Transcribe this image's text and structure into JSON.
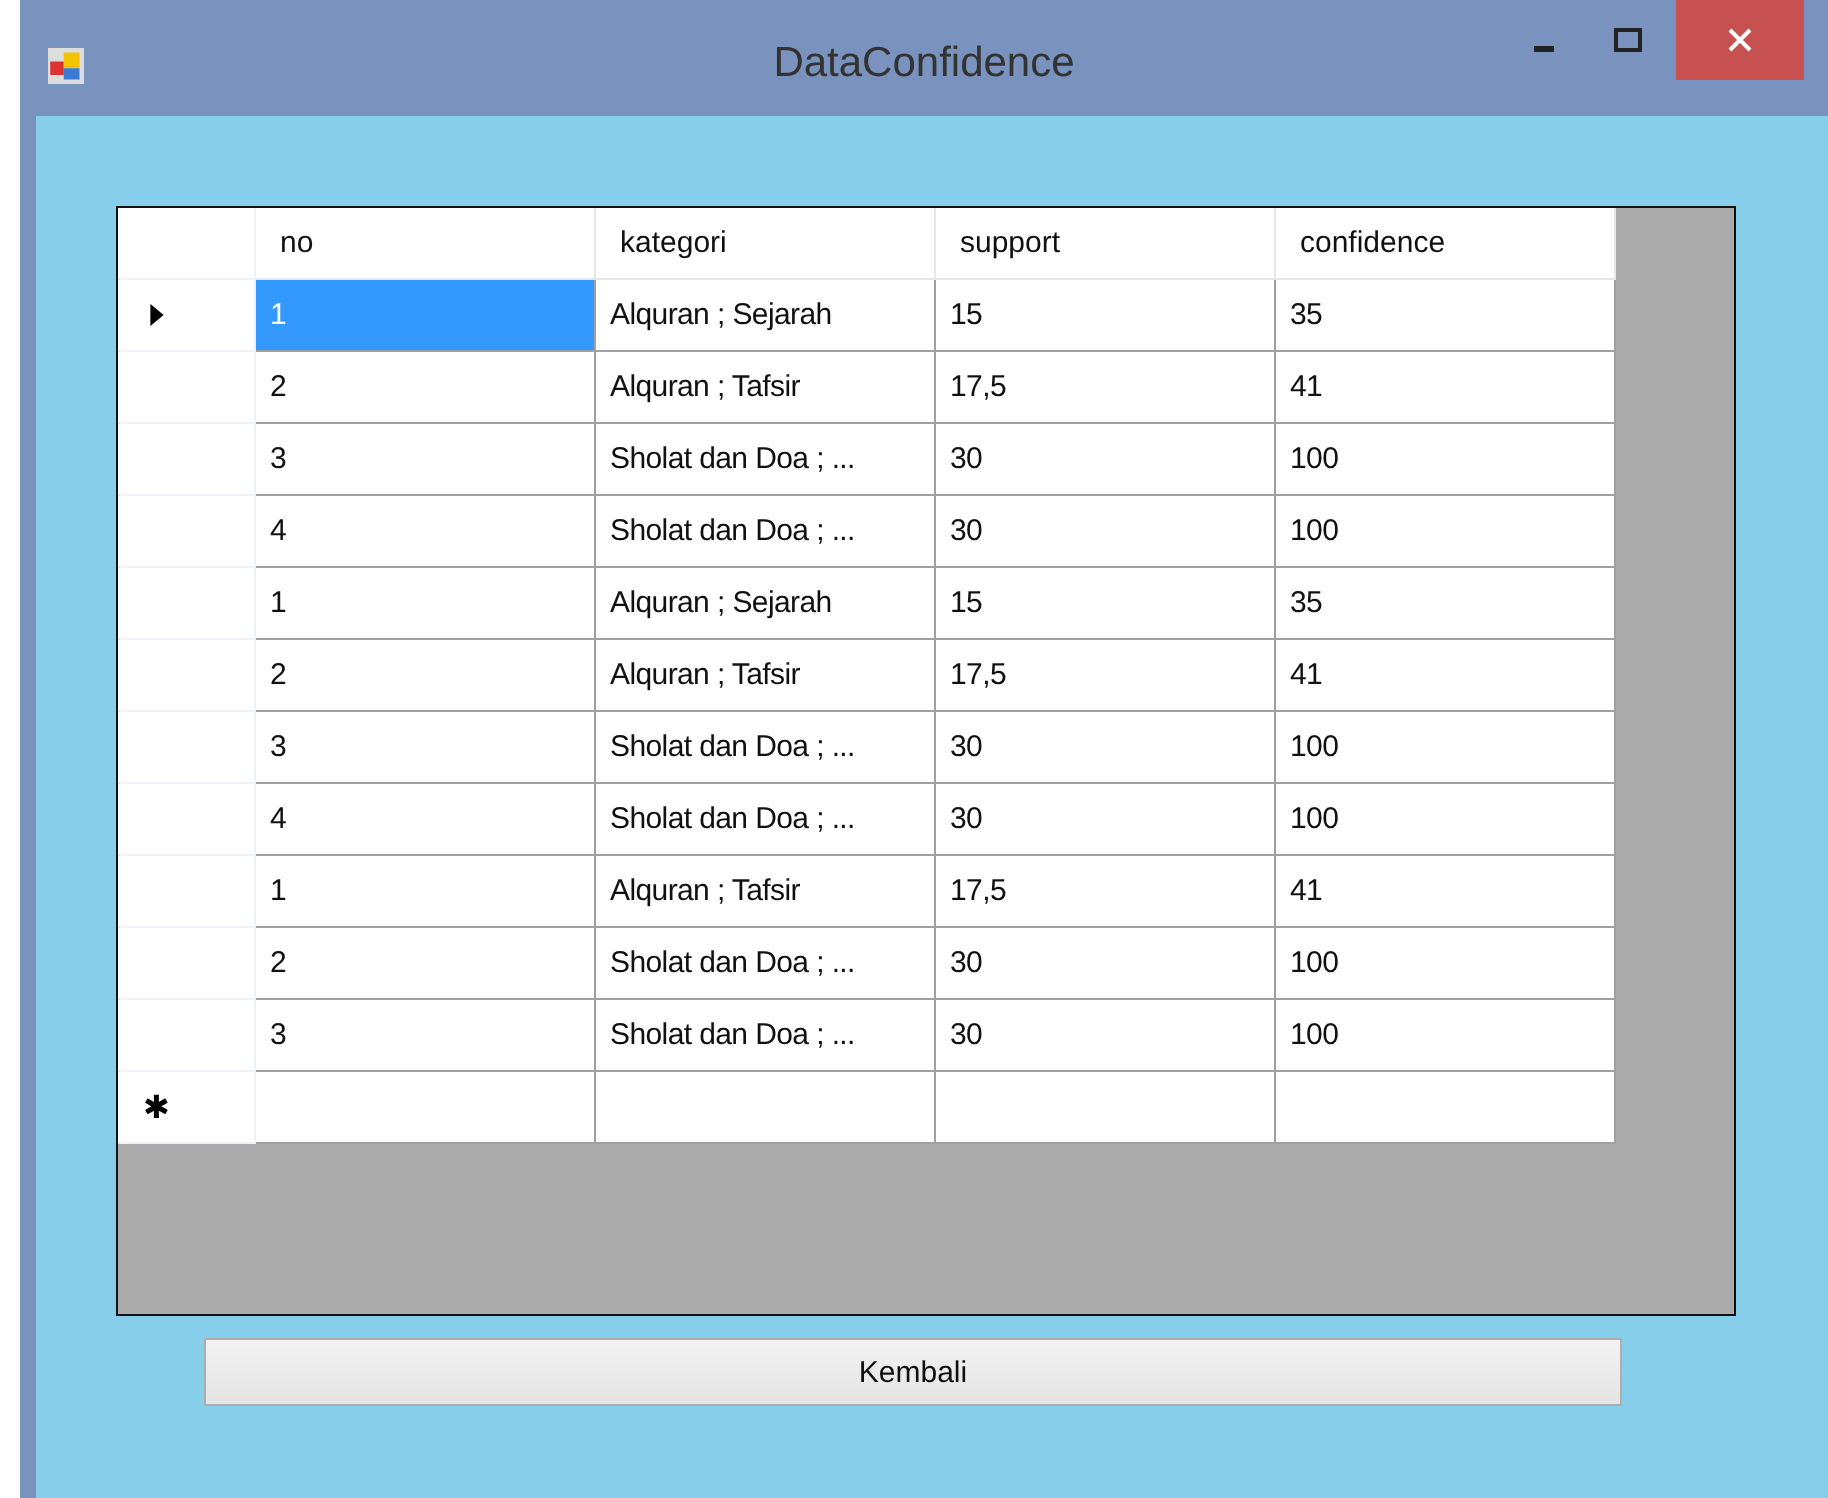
{
  "window": {
    "title": "DataConfidence"
  },
  "table": {
    "columns": [
      "no",
      "kategori",
      "support",
      "confidence"
    ],
    "rows": [
      {
        "cells": [
          "1",
          "Alquran ; Sejarah",
          "15",
          "35"
        ],
        "selected": true
      },
      {
        "cells": [
          "2",
          "Alquran ; Tafsir",
          "17,5",
          "41"
        ],
        "selected": false
      },
      {
        "cells": [
          "3",
          "Sholat dan Doa ; ...",
          "30",
          "100"
        ],
        "selected": false
      },
      {
        "cells": [
          "4",
          "Sholat dan Doa ; ...",
          "30",
          "100"
        ],
        "selected": false
      },
      {
        "cells": [
          "1",
          "Alquran ; Sejarah",
          "15",
          "35"
        ],
        "selected": false
      },
      {
        "cells": [
          "2",
          "Alquran ; Tafsir",
          "17,5",
          "41"
        ],
        "selected": false
      },
      {
        "cells": [
          "3",
          "Sholat dan Doa ; ...",
          "30",
          "100"
        ],
        "selected": false
      },
      {
        "cells": [
          "4",
          "Sholat dan Doa ; ...",
          "30",
          "100"
        ],
        "selected": false
      },
      {
        "cells": [
          "1",
          "Alquran ; Tafsir",
          "17,5",
          "41"
        ],
        "selected": false
      },
      {
        "cells": [
          "2",
          "Sholat dan Doa ; ...",
          "30",
          "100"
        ],
        "selected": false
      },
      {
        "cells": [
          "3",
          "Sholat dan Doa ; ...",
          "30",
          "100"
        ],
        "selected": false
      }
    ],
    "new_row_marker": "✱"
  },
  "buttons": [
    "Kembali"
  ]
}
